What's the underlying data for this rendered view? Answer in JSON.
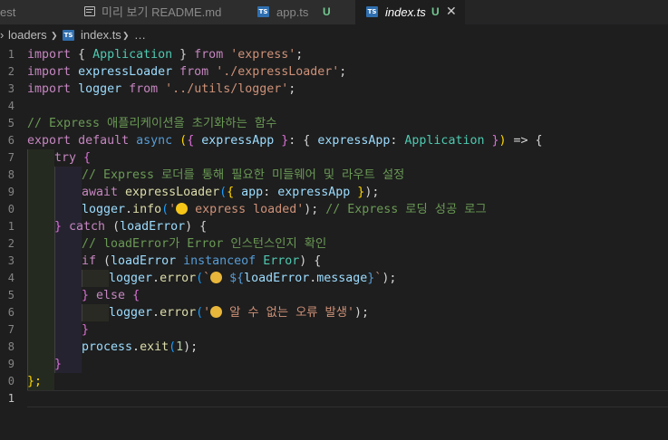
{
  "tabs": [
    {
      "label": "est"
    },
    {
      "label": "미리 보기 README.md"
    },
    {
      "label": "app.ts",
      "badge": "U"
    },
    {
      "label": "index.ts",
      "badge": "U",
      "close": "✕"
    }
  ],
  "ts_icon": "TS",
  "breadcrumb": {
    "folder": "loaders",
    "sep": "❯",
    "file": "index.ts",
    "more": "…"
  },
  "line_numbers": [
    "1",
    "2",
    "3",
    "4",
    "5",
    "6",
    "7",
    "8",
    "9",
    "0",
    "1",
    "2",
    "3",
    "4",
    "5",
    "6",
    "7",
    "8",
    "9",
    "0",
    "1"
  ],
  "code": {
    "l1": [
      "import",
      " { ",
      "Application",
      " } ",
      "from",
      " ",
      "'express'",
      ";"
    ],
    "l2": [
      "import",
      " ",
      "expressLoader",
      " ",
      "from",
      " ",
      "'./expressLoader'",
      ";"
    ],
    "l3": [
      "import",
      " ",
      "logger",
      " ",
      "from",
      " ",
      "'../utils/logger'",
      ";"
    ],
    "l5": [
      "// Express 애플리케이션을 초기화하는 함수"
    ],
    "l6": [
      "export",
      " ",
      "default",
      " ",
      "async",
      " ",
      "(",
      "{",
      " expressApp ",
      "}",
      ": { ",
      "expressApp",
      ": ",
      "Application",
      " }",
      ")",
      " => {"
    ],
    "l7": [
      "try",
      " {"
    ],
    "l8": [
      "// Express 로더를 통해 필요한 미들웨어 및 라우트 설정"
    ],
    "l9": [
      "await",
      " ",
      "expressLoader",
      "(",
      "{",
      " ",
      "app",
      ": ",
      "expressApp",
      " ",
      "}",
      ");"
    ],
    "l10": [
      "logger",
      ".",
      "info",
      "(",
      "'",
      " express loaded'",
      ");",
      " ",
      "// Express 로딩 성공 로그"
    ],
    "l11": [
      "}",
      " ",
      "catch",
      " (",
      "loadError",
      ") {"
    ],
    "l12": [
      "// loadError가 Error 인스턴스인지 확인"
    ],
    "l13": [
      "if",
      " (",
      "loadError",
      " ",
      "instanceof",
      " ",
      "Error",
      ") {"
    ],
    "l14": [
      "logger",
      ".",
      "error",
      "(",
      "`",
      " ",
      "${",
      "loadError",
      ".",
      "message",
      "}",
      "`",
      ");"
    ],
    "l15": [
      "}",
      " ",
      "else",
      " {"
    ],
    "l16": [
      "logger",
      ".",
      "error",
      "(",
      "'",
      " 알 수 없는 오류 발생'",
      ");"
    ],
    "l17": [
      "}"
    ],
    "l18": [
      "process",
      ".",
      "exit",
      "(",
      "1",
      ");"
    ],
    "l19": [
      "}"
    ],
    "l20": [
      "};"
    ]
  },
  "colors": {
    "keyword": "#569cd6",
    "control": "#c586c0",
    "string": "#ce9178",
    "variable": "#9cdcfe",
    "type": "#4ec9b0",
    "function": "#dcdcaa",
    "comment": "#6a9955",
    "number": "#b5cea8",
    "badge_untracked": "#73c991"
  },
  "icons": [
    "markdown-preview-icon",
    "typescript-file-icon",
    "close-icon",
    "chevron-right-icon",
    "emoji-star-struck-icon",
    "emoji-thinking-face-icon"
  ]
}
